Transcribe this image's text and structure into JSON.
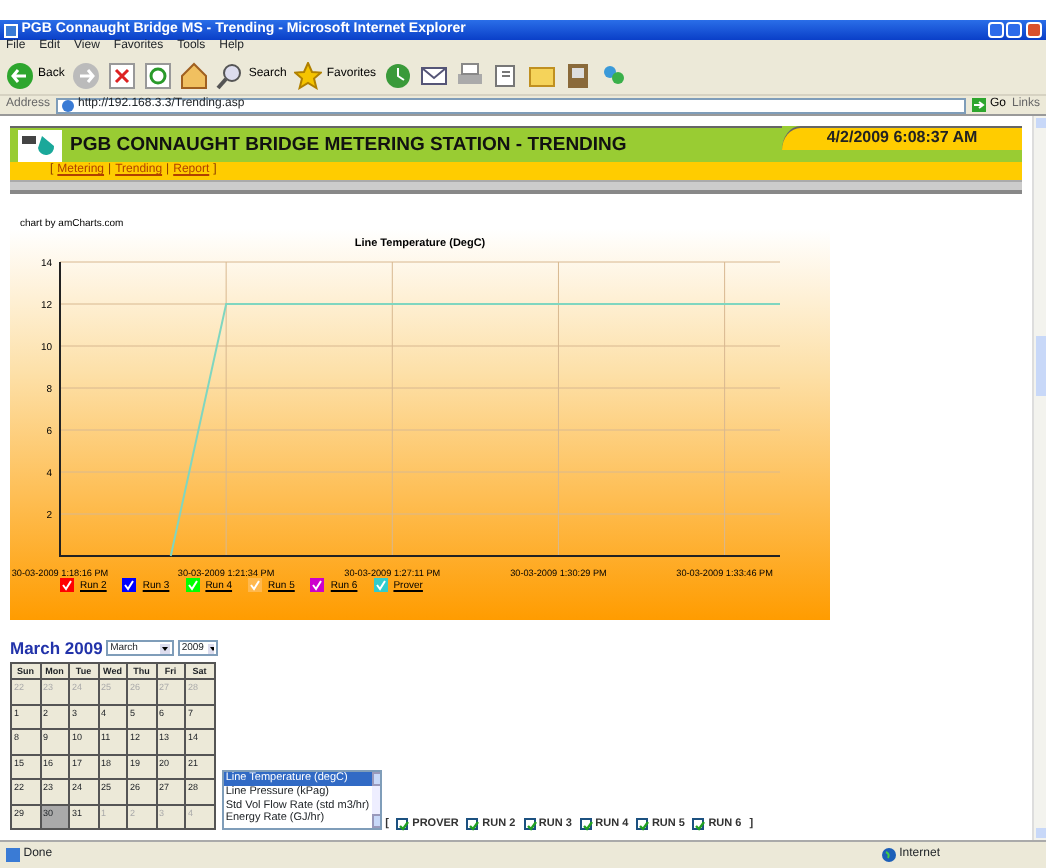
{
  "window": {
    "title": "PGB Connaught Bridge MS - Trending - Microsoft Internet Explorer"
  },
  "menu": [
    "File",
    "Edit",
    "View",
    "Favorites",
    "Tools",
    "Help"
  ],
  "toolbar": [
    {
      "kind": "back",
      "label": "Back"
    },
    {
      "kind": "forward"
    },
    {
      "kind": "stop"
    },
    {
      "kind": "refresh"
    },
    {
      "kind": "home"
    },
    {
      "kind": "search",
      "label": "Search"
    },
    {
      "kind": "favorites",
      "label": "Favorites"
    },
    {
      "kind": "history"
    },
    {
      "kind": "mail"
    },
    {
      "kind": "print"
    },
    {
      "kind": "edit"
    },
    {
      "kind": "folder"
    },
    {
      "kind": "research"
    },
    {
      "kind": "messenger"
    }
  ],
  "address_bar": {
    "label": "Address",
    "url": "http://192.168.3.3/Trending.asp",
    "go": "Go",
    "links": "Links"
  },
  "header": {
    "title": "PGB CONNAUGHT BRIDGE METERING STATION - TRENDING",
    "datetime": "4/2/2009 6:08:37 AM",
    "nav": [
      "Metering",
      "Trending",
      "Report"
    ],
    "nav_open": "[",
    "nav_separator": "|",
    "nav_close": "]"
  },
  "chart": {
    "credit": "chart by amCharts.com",
    "chart_data": {
      "type": "line",
      "title": "Line Temperature (DegC)",
      "categories": [
        "30-03-2009 1:18:16 PM",
        null,
        null,
        "30-03-2009 1:21:34 PM",
        null,
        null,
        "30-03-2009 1:27:11 PM",
        null,
        null,
        "30-03-2009 1:30:29 PM",
        null,
        null,
        "30-03-2009 1:33:46 PM",
        null
      ],
      "series": [
        {
          "color": "#7fd6c0",
          "values": [
            null,
            null,
            0,
            12,
            12,
            12,
            12,
            12,
            12,
            12,
            12,
            12,
            12,
            12
          ]
        }
      ],
      "ylim": [
        0,
        14
      ],
      "yticks": [
        2,
        4,
        6,
        8,
        10,
        12,
        14
      ],
      "grid": true
    },
    "legend": [
      {
        "label": "Run 2",
        "color": "#ff0000",
        "checked": true
      },
      {
        "label": "Run 3",
        "color": "#0000ff",
        "checked": true
      },
      {
        "label": "Run 4",
        "color": "#00ff00",
        "checked": true
      },
      {
        "label": "Run 5",
        "color": "#ffb84d",
        "checked": true
      },
      {
        "label": "Run 6",
        "color": "#cc00cc",
        "checked": true
      },
      {
        "label": "Prover",
        "color": "#33cccc",
        "checked": true
      }
    ]
  },
  "calendar": {
    "title": "March 2009",
    "month": "March",
    "year": "2009",
    "weekdays": [
      "Sun",
      "Mon",
      "Tue",
      "Wed",
      "Thu",
      "Fri",
      "Sat"
    ],
    "weeks": [
      [
        {
          "day": "22",
          "other_month": true,
          "selected": false
        },
        {
          "day": "23",
          "other_month": true,
          "selected": false
        },
        {
          "day": "24",
          "other_month": true,
          "selected": false
        },
        {
          "day": "25",
          "other_month": true,
          "selected": false
        },
        {
          "day": "26",
          "other_month": true,
          "selected": false
        },
        {
          "day": "27",
          "other_month": true,
          "selected": false
        },
        {
          "day": "28",
          "other_month": true,
          "selected": false
        }
      ],
      [
        {
          "day": "1",
          "other_month": false,
          "selected": false
        },
        {
          "day": "2",
          "other_month": false,
          "selected": false
        },
        {
          "day": "3",
          "other_month": false,
          "selected": false
        },
        {
          "day": "4",
          "other_month": false,
          "selected": false
        },
        {
          "day": "5",
          "other_month": false,
          "selected": false
        },
        {
          "day": "6",
          "other_month": false,
          "selected": false
        },
        {
          "day": "7",
          "other_month": false,
          "selected": false
        }
      ],
      [
        {
          "day": "8",
          "other_month": false,
          "selected": false
        },
        {
          "day": "9",
          "other_month": false,
          "selected": false
        },
        {
          "day": "10",
          "other_month": false,
          "selected": false
        },
        {
          "day": "11",
          "other_month": false,
          "selected": false
        },
        {
          "day": "12",
          "other_month": false,
          "selected": false
        },
        {
          "day": "13",
          "other_month": false,
          "selected": false
        },
        {
          "day": "14",
          "other_month": false,
          "selected": false
        }
      ],
      [
        {
          "day": "15",
          "other_month": false,
          "selected": false
        },
        {
          "day": "16",
          "other_month": false,
          "selected": false
        },
        {
          "day": "17",
          "other_month": false,
          "selected": false
        },
        {
          "day": "18",
          "other_month": false,
          "selected": false
        },
        {
          "day": "19",
          "other_month": false,
          "selected": false
        },
        {
          "day": "20",
          "other_month": false,
          "selected": false
        },
        {
          "day": "21",
          "other_month": false,
          "selected": false
        }
      ],
      [
        {
          "day": "22",
          "other_month": false,
          "selected": false
        },
        {
          "day": "23",
          "other_month": false,
          "selected": false
        },
        {
          "day": "24",
          "other_month": false,
          "selected": false
        },
        {
          "day": "25",
          "other_month": false,
          "selected": false
        },
        {
          "day": "26",
          "other_month": false,
          "selected": false
        },
        {
          "day": "27",
          "other_month": false,
          "selected": false
        },
        {
          "day": "28",
          "other_month": false,
          "selected": false
        }
      ],
      [
        {
          "day": "29",
          "other_month": false,
          "selected": false
        },
        {
          "day": "30",
          "other_month": false,
          "selected": true
        },
        {
          "day": "31",
          "other_month": false,
          "selected": false
        },
        {
          "day": "1",
          "other_month": true,
          "selected": false
        },
        {
          "day": "2",
          "other_month": true,
          "selected": false
        },
        {
          "day": "3",
          "other_month": true,
          "selected": false
        },
        {
          "day": "4",
          "other_month": true,
          "selected": false
        }
      ]
    ]
  },
  "parameters": [
    {
      "label": "Line Temperature (degC)",
      "selected": true
    },
    {
      "label": "Line Pressure (kPag)",
      "selected": false
    },
    {
      "label": "Std Vol Flow Rate (std m3/hr)",
      "selected": false
    },
    {
      "label": "Energy Rate (GJ/hr)",
      "selected": false
    }
  ],
  "runs_open": "[",
  "runs_close": "]",
  "runs": [
    {
      "label": "PROVER",
      "checked": true
    },
    {
      "label": "RUN 2",
      "checked": true
    },
    {
      "label": "RUN 3",
      "checked": true
    },
    {
      "label": "RUN 4",
      "checked": true
    },
    {
      "label": "RUN 5",
      "checked": true
    },
    {
      "label": "RUN 6",
      "checked": true
    }
  ],
  "status_bar": {
    "text": "Done",
    "zone": "Internet"
  }
}
